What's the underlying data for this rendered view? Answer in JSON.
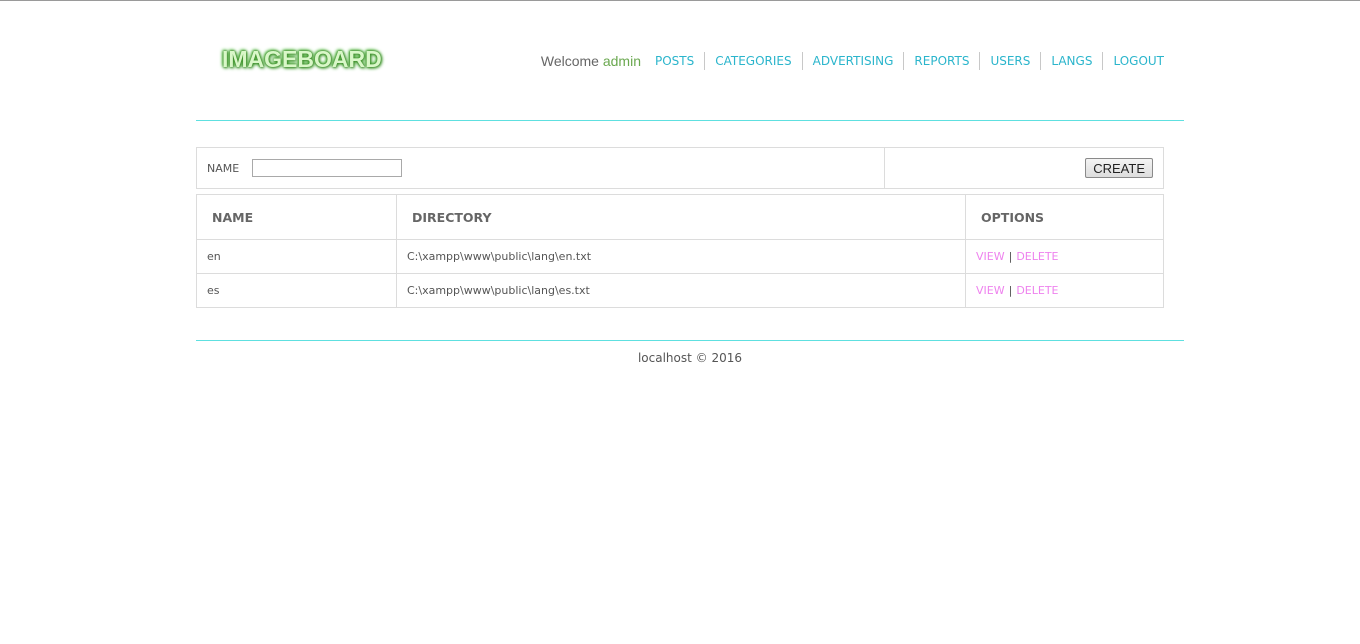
{
  "header": {
    "logo_text": "IMAGEBOARD",
    "welcome_label": "Welcome",
    "username": "admin",
    "nav": [
      {
        "label": "POSTS"
      },
      {
        "label": "CATEGORIES"
      },
      {
        "label": "ADVERTISING"
      },
      {
        "label": "REPORTS"
      },
      {
        "label": "USERS"
      },
      {
        "label": "LANGS"
      },
      {
        "label": "LOGOUT"
      }
    ]
  },
  "form": {
    "name_label": "NAME",
    "name_value": "",
    "create_label": "CREATE"
  },
  "table": {
    "headers": [
      "NAME",
      "DIRECTORY",
      "OPTIONS"
    ],
    "rows": [
      {
        "name": "en",
        "directory": "C:\\xampp\\www\\public\\lang\\en.txt",
        "view": "VIEW",
        "delete": "DELETE"
      },
      {
        "name": "es",
        "directory": "C:\\xampp\\www\\public\\lang\\es.txt",
        "view": "VIEW",
        "delete": "DELETE"
      }
    ],
    "separator": "|"
  },
  "footer": {
    "text": "localhost © 2016"
  },
  "colors": {
    "nav_link": "#2bb5cc",
    "username": "#6aa84f",
    "option_link": "#ee82ee",
    "rule": "#5ee0e0"
  }
}
